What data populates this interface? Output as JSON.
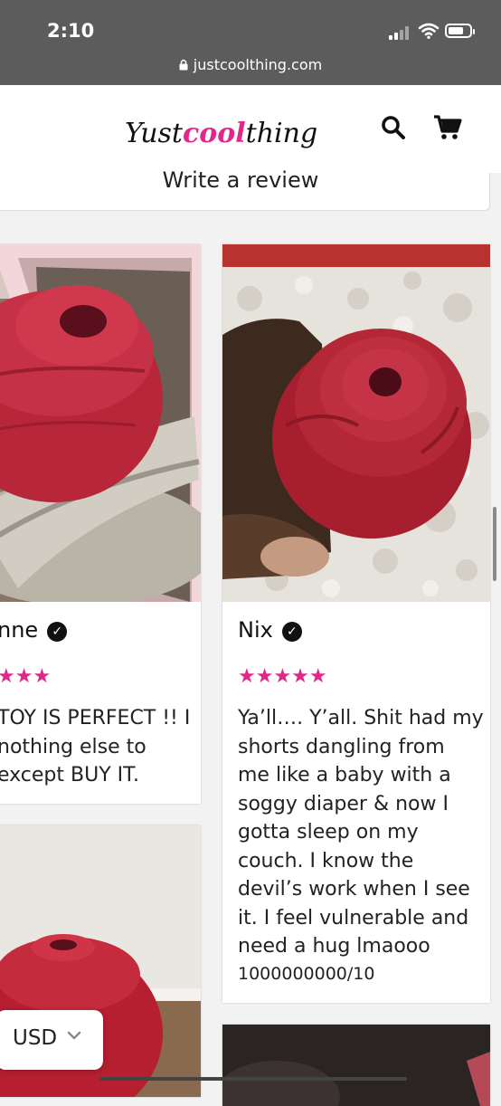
{
  "status_bar": {
    "time": "2:10",
    "url": "justcoolthing.com"
  },
  "header": {
    "logo": {
      "part1": "Yust",
      "part2": "cool",
      "part3": "thing"
    },
    "icons": [
      "search-icon",
      "cart-icon"
    ]
  },
  "write_review_label": "Write a review",
  "reviews": [
    {
      "name": "nne",
      "stars": "★★★",
      "rating": 5,
      "text": "TOY IS PERFECT !! I\n nothing else to\nexcept BUY IT."
    },
    {
      "name": "Nix",
      "stars": "★★★★★",
      "rating": 5,
      "text": "Ya’ll…. Y’all. Shit had my\nshorts dangling from\nme like a baby with a\nsoggy diaper & now I\ngotta sleep on my\ncouch. I know the\ndevil’s work when I see\nit. I feel vulnerable and\nneed a hug lmaooo",
      "text_tail": "1000000000/10"
    }
  ],
  "currency": {
    "code": "USD"
  },
  "colors": {
    "accent": "#e0288a",
    "rose": "#c8323f",
    "status_bar": "#5c5c5c"
  }
}
